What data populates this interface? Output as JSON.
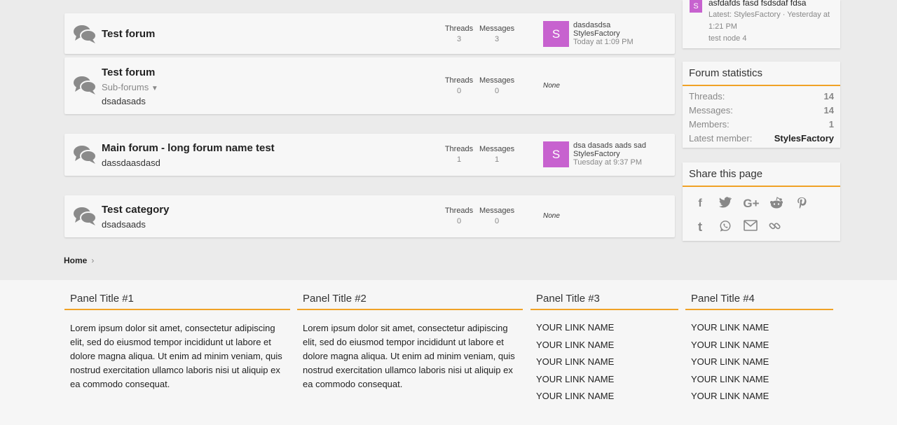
{
  "forums": [
    {
      "title": "Test forum",
      "description": "",
      "subforums": "",
      "threads_label": "Threads",
      "threads": "3",
      "messages_label": "Messages",
      "messages": "3",
      "last": {
        "avatar": "S",
        "title": "dasdasdsa",
        "user": "StylesFactory",
        "time": "Today at 1:09 PM"
      }
    },
    {
      "title": "Test forum",
      "description": "dsadasads",
      "subforums": "Sub-forums",
      "threads_label": "Threads",
      "threads": "0",
      "messages_label": "Messages",
      "messages": "0",
      "last": {
        "none": "None"
      }
    },
    {
      "title": "Main forum - long forum name test",
      "description": "dassdaasdasd",
      "subforums": "",
      "threads_label": "Threads",
      "threads": "1",
      "messages_label": "Messages",
      "messages": "1",
      "last": {
        "avatar": "S",
        "title": "dsa dasads aads sad",
        "user": "StylesFactory",
        "time": "Tuesday at 9:37 PM"
      }
    },
    {
      "title": "Test category",
      "description": "dsadsaads",
      "subforums": "",
      "threads_label": "Threads",
      "threads": "0",
      "messages_label": "Messages",
      "messages": "0",
      "last": {
        "none": "None"
      }
    }
  ],
  "sidebar": {
    "latest": {
      "avatar": "S",
      "title": "asfdafds fasd fsdsdaf fdsa",
      "meta": "Latest: StylesFactory · Yesterday at",
      "meta2": "1:21 PM",
      "node": "test node 4"
    },
    "stats": {
      "title": "Forum statistics",
      "rows": [
        {
          "label": "Threads:",
          "value": "14"
        },
        {
          "label": "Messages:",
          "value": "14"
        },
        {
          "label": "Members:",
          "value": "1"
        },
        {
          "label": "Latest member:",
          "value": "StylesFactory"
        }
      ]
    },
    "share": {
      "title": "Share this page",
      "icons": [
        "facebook-icon",
        "twitter-icon",
        "google-plus-icon",
        "reddit-icon",
        "pinterest-icon",
        "tumblr-icon",
        "whatsapp-icon",
        "email-icon",
        "link-icon"
      ]
    }
  },
  "breadcrumb": {
    "home": "Home",
    "sep": "›"
  },
  "panels": [
    {
      "title": "Panel Title #1",
      "text": "Lorem ipsum dolor sit amet, consectetur adipiscing elit, sed do eiusmod tempor incididunt ut labore et dolore magna aliqua. Ut enim ad minim veniam, quis nostrud exercitation ullamco laboris nisi ut aliquip ex ea commodo consequat."
    },
    {
      "title": "Panel Title #2",
      "text": "Lorem ipsum dolor sit amet, consectetur adipiscing elit, sed do eiusmod tempor incididunt ut labore et dolore magna aliqua. Ut enim ad minim veniam, quis nostrud exercitation ullamco laboris nisi ut aliquip ex ea commodo consequat."
    },
    {
      "title": "Panel Title #3",
      "links": [
        "YOUR LINK NAME",
        "YOUR LINK NAME",
        "YOUR LINK NAME",
        "YOUR LINK NAME",
        "YOUR LINK NAME"
      ]
    },
    {
      "title": "Panel Title #4",
      "links": [
        "YOUR LINK NAME",
        "YOUR LINK NAME",
        "YOUR LINK NAME",
        "YOUR LINK NAME",
        "YOUR LINK NAME"
      ]
    }
  ],
  "colors": {
    "accent": "#f0a226",
    "avatar": "#c762cf"
  }
}
